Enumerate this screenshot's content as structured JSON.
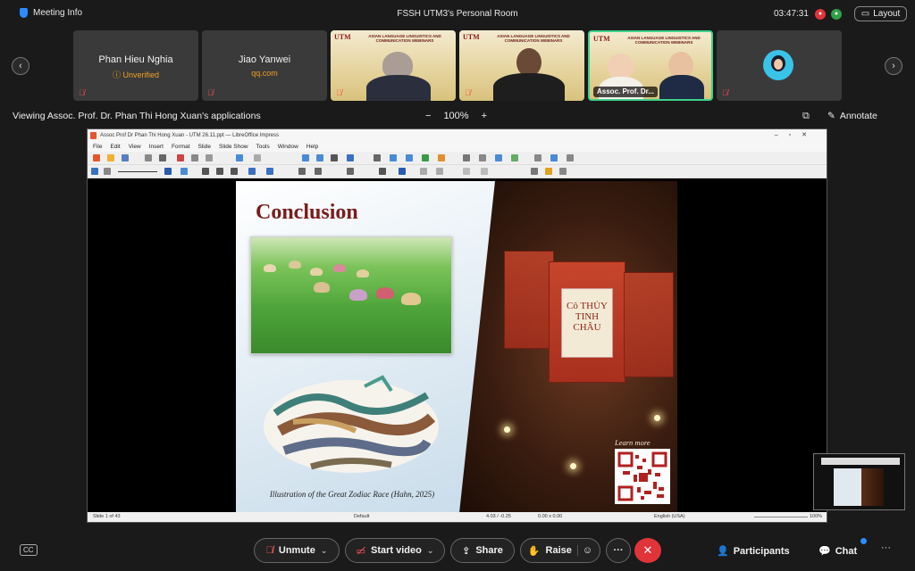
{
  "topbar": {
    "meeting_info": "Meeting Info",
    "room_title": "FSSH UTM3's Personal Room",
    "clock": "03:47:31",
    "layout_label": "Layout"
  },
  "gallery": {
    "participants": [
      {
        "name": "Phan Hieu Nghia",
        "sub": "Unverified"
      },
      {
        "name": "Jiao Yanwei",
        "sub": "qq.com"
      }
    ],
    "video_label": "Assoc. Prof. Dr...",
    "banner_text": "ASIAN LANGUAGE LINGUISTICS AND COMMUNICATION WEBINARS",
    "utm": "UTM"
  },
  "viewing": {
    "text": "Viewing Assoc. Prof. Dr. Phan Thi Hong Xuan's applications",
    "zoom": "100%",
    "minus": "−",
    "plus": "+",
    "annotate": "Annotate"
  },
  "office": {
    "title": "Assoc Prof Dr Phan Thi Hong Xuan - UTM 26.11.ppt — LibreOffice Impress",
    "menu": [
      "File",
      "Edit",
      "View",
      "Insert",
      "Format",
      "Slide",
      "Slide Show",
      "Tools",
      "Window",
      "Help"
    ],
    "status_slide": "Slide 1 of 43",
    "status_layout": "Default",
    "status_pos": "4.03 / -0.25",
    "status_size": "0.00 x 0.00",
    "status_lang": "English (USA)",
    "status_zoom": "100%"
  },
  "slide": {
    "title": "Conclusion",
    "caption": "Illustration of the Great Zodiac Race (Hahn, 2025)",
    "learn_more": "Learn more",
    "box_text": "Cô THỦY TINH CHÂU"
  },
  "bottombar": {
    "unmute": "Unmute",
    "start_video": "Start video",
    "share": "Share",
    "raise": "Raise",
    "participants": "Participants",
    "chat": "Chat",
    "more": "···",
    "end": "✕",
    "cc": "CC"
  },
  "colors": {
    "brand_blue": "#2d8cff",
    "end_red": "#e0343a",
    "unverified_orange": "#f0a020",
    "active_border": "#3fd18b"
  }
}
